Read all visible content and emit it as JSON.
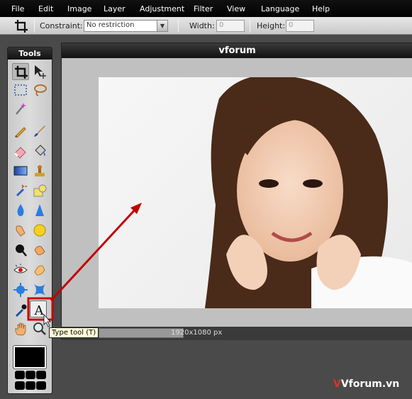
{
  "menu": {
    "items": [
      "File",
      "Edit",
      "Image",
      "Layer",
      "Adjustment",
      "Filter",
      "View",
      "Language",
      "Help"
    ]
  },
  "options_bar": {
    "constraint_label": "Constraint:",
    "constraint_value": "No restriction",
    "width_label": "Width:",
    "width_value": "0",
    "height_label": "Height:",
    "height_value": "0"
  },
  "tools_panel": {
    "title": "Tools",
    "tools": [
      "crop-tool",
      "move-tool",
      "marquee-tool",
      "lasso-tool",
      "magic-wand-tool",
      "pencil-tool",
      "brush-tool",
      "eraser-tool",
      "paint-bucket-tool",
      "gradient-tool",
      "clone-stamp-tool",
      "color-replace-tool",
      "drawing-tool",
      "blur-tool",
      "sharpen-tool",
      "smudge-tool",
      "sponge-tool",
      "dodge-tool",
      "burn-tool",
      "red-eye-tool",
      "spot-heal-tool",
      "bloat-tool",
      "pinch-tool",
      "color-picker-tool",
      "type-tool",
      "hand-tool",
      "zoom-tool"
    ],
    "foreground_color": "#000000"
  },
  "document": {
    "title": "vforum",
    "image_size": "1920x1080 px"
  },
  "tooltip": {
    "text": "Type tool (T)"
  },
  "watermark": {
    "text": "Vforum.vn"
  },
  "colors": {
    "annotation_red": "#c40000",
    "menubar_bg": "#000000",
    "tooltip_bg": "#ffffd8"
  }
}
